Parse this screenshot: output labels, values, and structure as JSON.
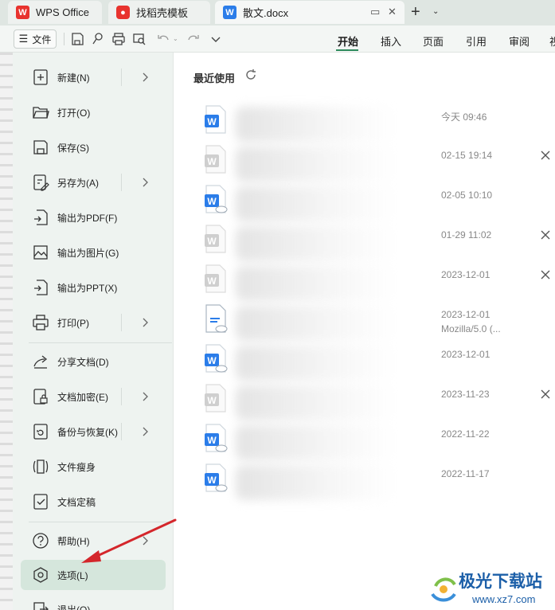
{
  "tabs": [
    {
      "label": "WPS Office",
      "logo": "wps-logo-icon"
    },
    {
      "label": "找稻壳模板",
      "logo": "docer-logo-icon"
    },
    {
      "label": "散文.docx",
      "logo": "word-doc-icon"
    }
  ],
  "toolbar": {
    "file_label": "文件",
    "ribbon_tabs": [
      "开始",
      "插入",
      "页面",
      "引用",
      "审阅",
      "视"
    ]
  },
  "menu": {
    "items": [
      {
        "label": "新建(N)",
        "icon": "new-file-icon",
        "submenu": true
      },
      {
        "label": "打开(O)",
        "icon": "folder-open-icon",
        "submenu": false
      },
      {
        "label": "保存(S)",
        "icon": "save-icon",
        "submenu": false
      },
      {
        "label": "另存为(A)",
        "icon": "save-as-icon",
        "submenu": true
      },
      {
        "label": "输出为PDF(F)",
        "icon": "export-pdf-icon",
        "submenu": false
      },
      {
        "label": "输出为图片(G)",
        "icon": "export-image-icon",
        "submenu": false
      },
      {
        "label": "输出为PPT(X)",
        "icon": "export-ppt-icon",
        "submenu": false
      },
      {
        "label": "打印(P)",
        "icon": "printer-icon",
        "submenu": true
      },
      {
        "label": "分享文档(D)",
        "icon": "share-icon",
        "submenu": false
      },
      {
        "label": "文档加密(E)",
        "icon": "encrypt-icon",
        "submenu": true
      },
      {
        "label": "备份与恢复(K)",
        "icon": "backup-icon",
        "submenu": true
      },
      {
        "label": "文件瘦身",
        "icon": "slim-file-icon",
        "submenu": false
      },
      {
        "label": "文档定稿",
        "icon": "finalize-icon",
        "submenu": false
      },
      {
        "label": "帮助(H)",
        "icon": "help-icon",
        "submenu": true
      },
      {
        "label": "选项(L)",
        "icon": "options-gear-icon",
        "submenu": false,
        "selected": true
      },
      {
        "label": "退出(Q)",
        "icon": "exit-icon",
        "submenu": false
      }
    ]
  },
  "recent": {
    "title": "最近使用",
    "files": [
      {
        "time": "今天 09:46",
        "icon": "word-blue",
        "closable": false
      },
      {
        "time": "02-15 19:14",
        "icon": "word-gray",
        "closable": true
      },
      {
        "time": "02-05 10:10",
        "icon": "word-blue-cloud",
        "closable": false
      },
      {
        "time": "01-29 11:02",
        "icon": "word-gray",
        "closable": true
      },
      {
        "time": "2023-12-01",
        "icon": "word-gray",
        "closable": true
      },
      {
        "time": "2023-12-01",
        "sub": "Mozilla/5.0 (...",
        "icon": "doc-outline-cloud",
        "closable": false
      },
      {
        "time": "2023-12-01",
        "icon": "word-blue-cloud",
        "closable": false
      },
      {
        "time": "2023-11-23",
        "icon": "word-gray",
        "closable": true
      },
      {
        "time": "2022-11-22",
        "icon": "word-blue-cloud",
        "closable": false
      },
      {
        "time": "2022-11-17",
        "icon": "word-blue-cloud",
        "closable": false
      }
    ]
  },
  "watermark": {
    "line1": "极光下载站",
    "line2": "www.xz7.com"
  },
  "colors": {
    "accent_green": "#2d8a5c",
    "word_blue": "#2b7de9",
    "annotation_red": "#d4262b",
    "watermark_blue": "#1c5fa8"
  }
}
